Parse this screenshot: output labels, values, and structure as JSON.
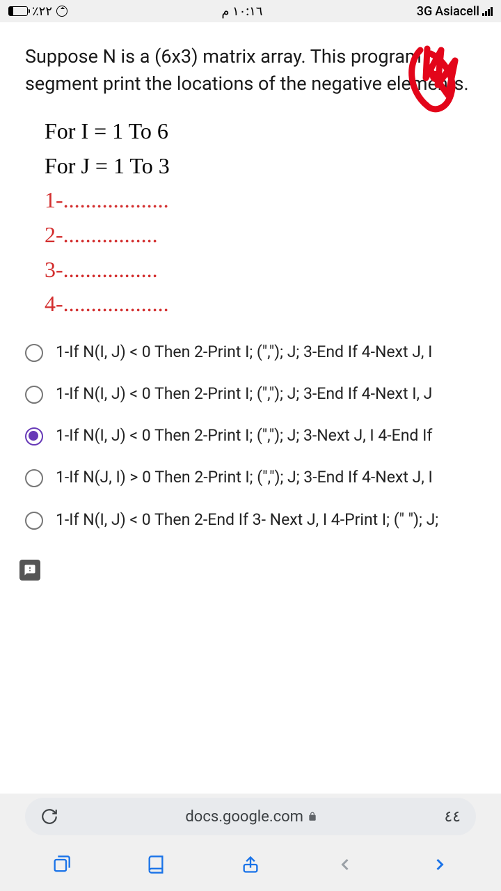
{
  "status": {
    "battery_pct": "٪٢٢",
    "time": "١٠:١٦ م",
    "network": "3G",
    "carrier": "Asiacell"
  },
  "question": {
    "text": "Suppose N is a (6x3) matrix array. This program segment print the locations of the negative elements."
  },
  "code": {
    "line1": "For I = 1 To 6",
    "line2": "For J = 1 To 3",
    "blank1": "1-...................",
    "blank2": "2-.................",
    "blank3": "3-.................",
    "blank4": "4-..................."
  },
  "options": [
    {
      "label": "1-If N(I, J) < 0 Then 2-Print I; (\",\"); J; 3-End If 4-Next J, I",
      "selected": false
    },
    {
      "label": "1-If N(I, J) < 0 Then 2-Print I; (\",\"); J; 3-End If 4-Next I, J",
      "selected": false
    },
    {
      "label": "1-If N(I, J) < 0 Then 2-Print I; (\",\"); J; 3-Next J, I 4-End If",
      "selected": true
    },
    {
      "label": "1-If N(J, I) > 0 Then 2-Print I; (\",\"); J; 3-End If 4-Next J, I",
      "selected": false
    },
    {
      "label": "1-If N(I, J) < 0 Then 2-End If 3- Next J, I 4-Print I; (\" \"); J;",
      "selected": false
    }
  ],
  "url": {
    "domain": "docs.google.com",
    "tabs": "٤٤"
  }
}
